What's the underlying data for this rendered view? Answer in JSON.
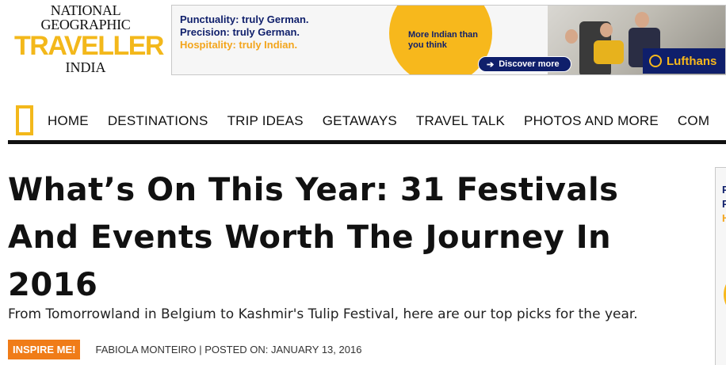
{
  "logo": {
    "line1": "NATIONAL",
    "line2": "GEOGRAPHIC",
    "line3": "TRAVELLER",
    "line4": "INDIA"
  },
  "banner_ad": {
    "tagline1": "Punctuality: truly German.",
    "tagline2": "Precision: truly German.",
    "tagline3": "Hospitality: truly Indian.",
    "sun_text": "More Indian than you think",
    "cta_label": "Discover more",
    "brand": "Lufthans",
    "colors": {
      "navy": "#0f1f6b",
      "yellow": "#f7b81c"
    }
  },
  "nav": {
    "items": [
      "HOME",
      "DESTINATIONS",
      "TRIP IDEAS",
      "GETAWAYS",
      "TRAVEL TALK",
      "PHOTOS AND MORE",
      "COM"
    ]
  },
  "article": {
    "headline": "What’s On This Year: 31 Festivals And Events Worth The Journey In 2016",
    "dek": "From Tomorrowland in Belgium to Kashmir's Tulip Festival, here are our top picks for the year.",
    "category_badge": "INSPIRE ME!",
    "byline": "FABIOLA MONTEIRO | POSTED ON: JANUARY 13, 2016"
  },
  "sidebar_ad": {
    "frag1": "P",
    "frag2": "P",
    "frag3": "H"
  },
  "colors": {
    "brand_yellow": "#f3b81b",
    "badge_orange": "#f07c18"
  }
}
